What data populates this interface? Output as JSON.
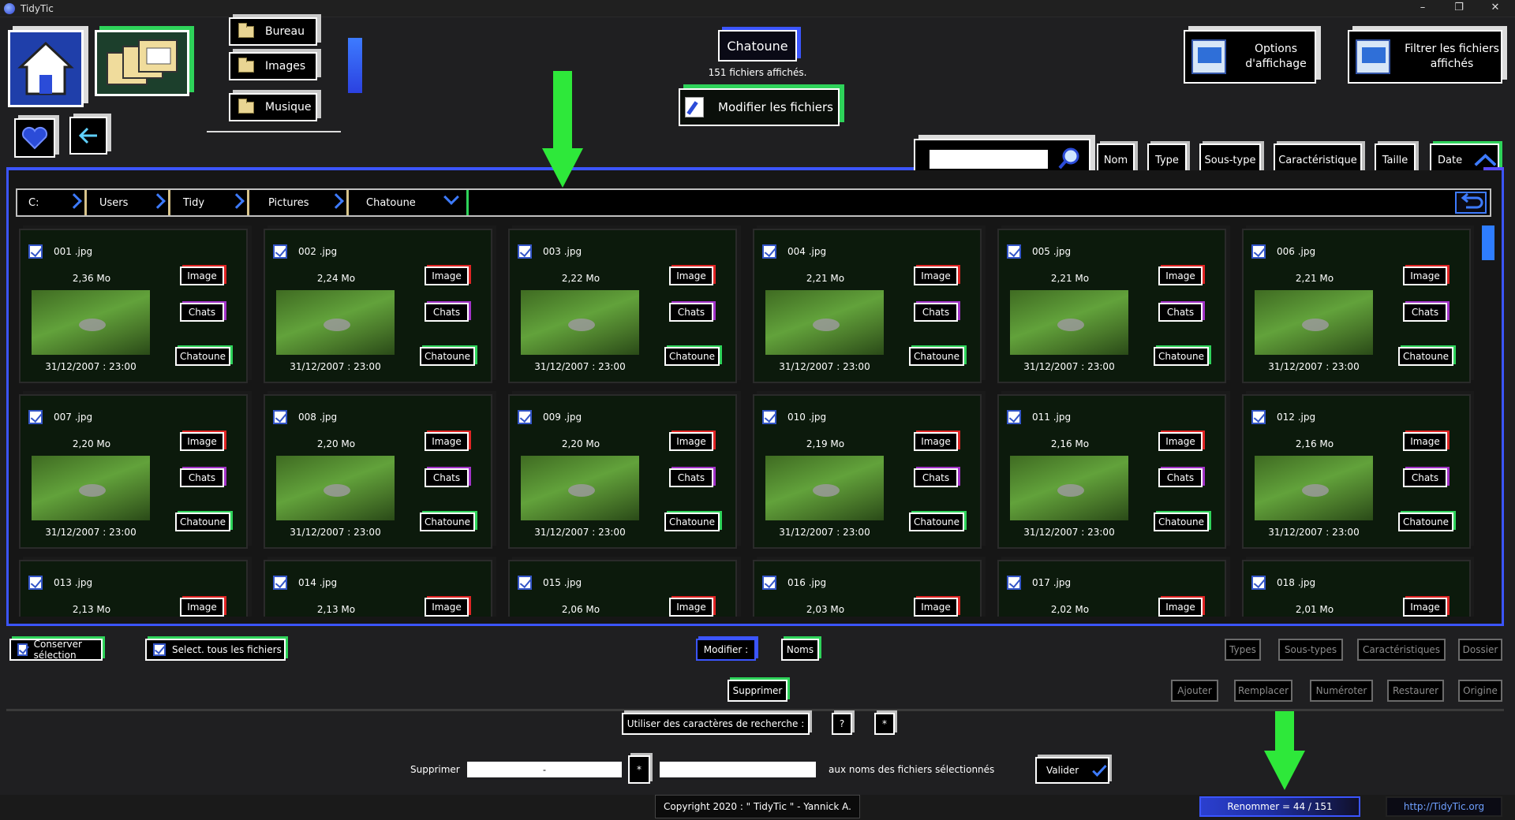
{
  "window": {
    "title": "TidyTic",
    "min": "–",
    "restore": "❐",
    "close": "✕"
  },
  "shortcuts": {
    "folders": [
      "Bureau",
      "Images",
      "Musique"
    ]
  },
  "current_folder": {
    "name": "Chatoune",
    "files_shown": "151 fichiers affichés.",
    "modify_label": "Modifier les fichiers"
  },
  "top_right": {
    "options_label": "Options d'affichage",
    "filter_label": "Filtrer les fichiers affichés"
  },
  "search": {
    "value": "",
    "placeholder": ""
  },
  "sort": {
    "buttons": [
      "Nom",
      "Type",
      "Sous-type",
      "Caractéristique",
      "Taille",
      "Date"
    ],
    "active": "Date"
  },
  "breadcrumb": [
    "C:",
    "Users",
    "Tidy",
    "Pictures",
    "Chatoune"
  ],
  "files": [
    {
      "name": "001 .jpg",
      "size": "2,36 Mo",
      "date": "31/12/2007 : 23:00"
    },
    {
      "name": "002 .jpg",
      "size": "2,24 Mo",
      "date": "31/12/2007 : 23:00"
    },
    {
      "name": "003 .jpg",
      "size": "2,22 Mo",
      "date": "31/12/2007 : 23:00"
    },
    {
      "name": "004 .jpg",
      "size": "2,21 Mo",
      "date": "31/12/2007 : 23:00"
    },
    {
      "name": "005 .jpg",
      "size": "2,21 Mo",
      "date": "31/12/2007 : 23:00"
    },
    {
      "name": "006 .jpg",
      "size": "2,21 Mo",
      "date": "31/12/2007 : 23:00"
    },
    {
      "name": "007 .jpg",
      "size": "2,20 Mo",
      "date": "31/12/2007 : 23:00"
    },
    {
      "name": "008 .jpg",
      "size": "2,20 Mo",
      "date": "31/12/2007 : 23:00"
    },
    {
      "name": "009 .jpg",
      "size": "2,20 Mo",
      "date": "31/12/2007 : 23:00"
    },
    {
      "name": "010 .jpg",
      "size": "2,19 Mo",
      "date": "31/12/2007 : 23:00"
    },
    {
      "name": "011 .jpg",
      "size": "2,16 Mo",
      "date": "31/12/2007 : 23:00"
    },
    {
      "name": "012 .jpg",
      "size": "2,16 Mo",
      "date": "31/12/2007 : 23:00"
    },
    {
      "name": "013 .jpg",
      "size": "2,13 Mo",
      "date": ""
    },
    {
      "name": "014 .jpg",
      "size": "2,13 Mo",
      "date": ""
    },
    {
      "name": "015 .jpg",
      "size": "2,06 Mo",
      "date": ""
    },
    {
      "name": "016 .jpg",
      "size": "2,03 Mo",
      "date": ""
    },
    {
      "name": "017 .jpg",
      "size": "2,02 Mo",
      "date": ""
    },
    {
      "name": "018 .jpg",
      "size": "2,01 Mo",
      "date": ""
    }
  ],
  "tags": {
    "type": "Image",
    "subtype": "Chats",
    "characteristic": "Chatoune"
  },
  "bottom": {
    "keep_selection": "Conserver sélection",
    "select_all": "Select. tous les fichiers",
    "modify_label": "Modifier :",
    "names": "Noms",
    "types": "Types",
    "subtypes": "Sous-types",
    "characteristics": "Caractéristiques",
    "folder": "Dossier",
    "delete": "Supprimer",
    "add": "Ajouter",
    "replace": "Remplacer",
    "number": "Numéroter",
    "restore": "Restaurer",
    "origin": "Origine",
    "use_search_chars": "Utiliser des caractères de recherche :",
    "q_mark": "?",
    "star": "*",
    "delete_label": "Supprimer",
    "input1_value": "-",
    "star_btn": "*",
    "input2_value": "",
    "suffix_text": "aux noms des fichiers sélectionnés",
    "validate": "Valider"
  },
  "status": {
    "copyright": "Copyright 2020 : \" TidyTic \" - Yannick A.",
    "rename_progress": "Renommer = 44 / 151",
    "site": "http://TidyTic.org"
  },
  "colors": {
    "accent_blue": "#3b55ff",
    "accent_green": "#2ed35a",
    "tag_red": "#e02424",
    "tag_purple": "#a232c8"
  }
}
